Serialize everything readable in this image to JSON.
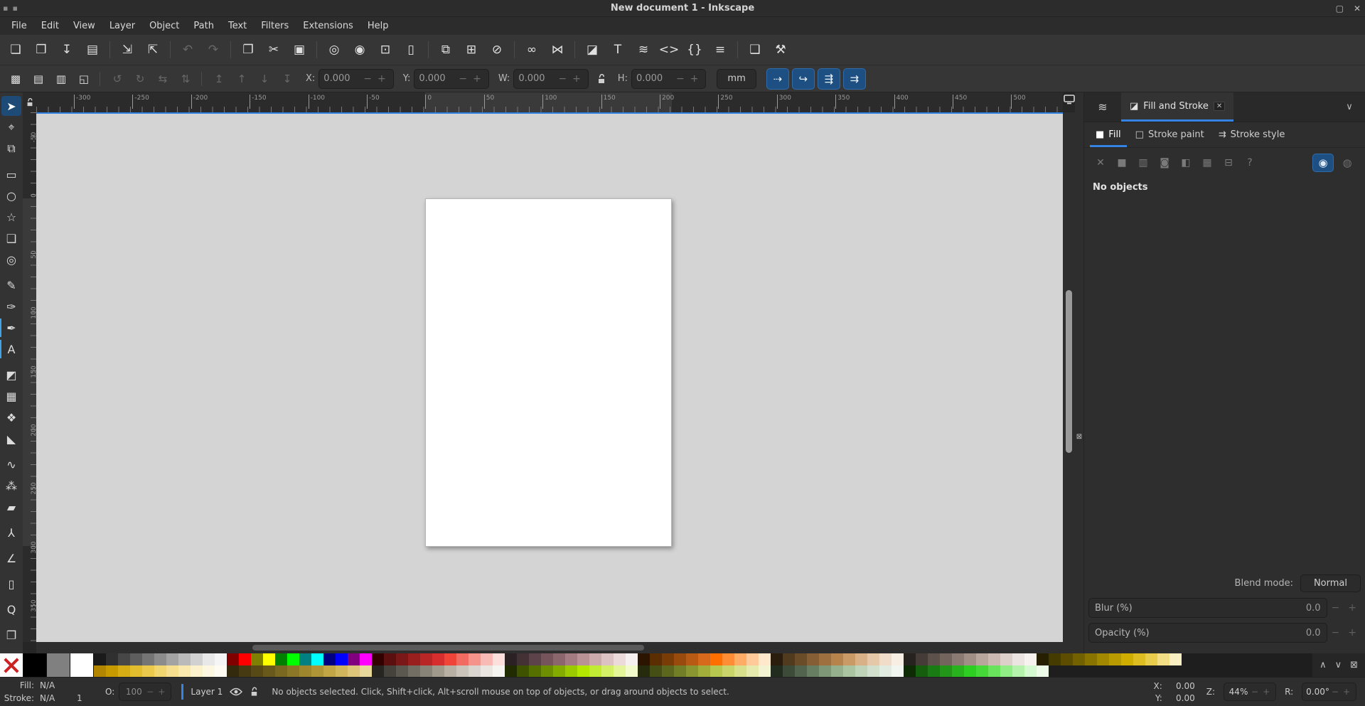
{
  "window": {
    "title": "New document 1 - Inkscape",
    "controls": {
      "restore": "▢",
      "close": "✕"
    },
    "app_menu_glyphs": [
      "▪",
      "▪"
    ]
  },
  "menubar": {
    "items": [
      {
        "name": "menu-file",
        "label": "File"
      },
      {
        "name": "menu-edit",
        "label": "Edit"
      },
      {
        "name": "menu-view",
        "label": "View"
      },
      {
        "name": "menu-layer",
        "label": "Layer"
      },
      {
        "name": "menu-object",
        "label": "Object"
      },
      {
        "name": "menu-path",
        "label": "Path"
      },
      {
        "name": "menu-text",
        "label": "Text"
      },
      {
        "name": "menu-filters",
        "label": "Filters"
      },
      {
        "name": "menu-extensions",
        "label": "Extensions"
      },
      {
        "name": "menu-help",
        "label": "Help"
      }
    ]
  },
  "command_toolbar": {
    "buttons": [
      {
        "name": "new-document-button",
        "glyph": "❏"
      },
      {
        "name": "open-document-button",
        "glyph": "❒"
      },
      {
        "name": "save-document-button",
        "glyph": "↧"
      },
      {
        "name": "print-button",
        "glyph": "▤",
        "sep_after": true
      },
      {
        "name": "import-button",
        "glyph": "⇲"
      },
      {
        "name": "export-button",
        "glyph": "⇱",
        "sep_after": true
      },
      {
        "name": "undo-button",
        "glyph": "↶",
        "disabled": true
      },
      {
        "name": "redo-button",
        "glyph": "↷",
        "disabled": true,
        "sep_after": true
      },
      {
        "name": "copy-button",
        "glyph": "❐"
      },
      {
        "name": "cut-button",
        "glyph": "✂"
      },
      {
        "name": "paste-button",
        "glyph": "▣",
        "sep_after": true
      },
      {
        "name": "zoom-selection-button",
        "glyph": "◎"
      },
      {
        "name": "zoom-drawing-button",
        "glyph": "◉"
      },
      {
        "name": "zoom-page-button",
        "glyph": "⊡"
      },
      {
        "name": "zoom-page-width-button",
        "glyph": "▯",
        "sep_after": true
      },
      {
        "name": "duplicate-button",
        "glyph": "⧉"
      },
      {
        "name": "clone-button",
        "glyph": "⊞"
      },
      {
        "name": "unlink-clone-button",
        "glyph": "⊘",
        "sep_after": true
      },
      {
        "name": "group-button",
        "glyph": "∞"
      },
      {
        "name": "ungroup-button",
        "glyph": "⋈",
        "sep_after": true
      },
      {
        "name": "fill-stroke-dialog-button",
        "glyph": "◪"
      },
      {
        "name": "text-dialog-button",
        "glyph": "T"
      },
      {
        "name": "layers-dialog-button",
        "glyph": "≋"
      },
      {
        "name": "xml-editor-button",
        "glyph": "<>"
      },
      {
        "name": "symbols-dialog-button",
        "glyph": "{}"
      },
      {
        "name": "align-distribute-button",
        "glyph": "≡",
        "sep_after": true
      },
      {
        "name": "document-properties-button",
        "glyph": "❑"
      },
      {
        "name": "preferences-button",
        "glyph": "⚒"
      }
    ]
  },
  "tool_options": {
    "selection_buttons": [
      {
        "name": "select-all-button",
        "glyph": "▩"
      },
      {
        "name": "select-all-layers-button",
        "glyph": "▤"
      },
      {
        "name": "deselect-button",
        "glyph": "▥"
      },
      {
        "name": "selection-box-button",
        "glyph": "◱",
        "sep_after": true
      }
    ],
    "transform_buttons": [
      {
        "name": "rotate-ccw-button",
        "glyph": "↺",
        "disabled": true
      },
      {
        "name": "rotate-cw-button",
        "glyph": "↻",
        "disabled": true
      },
      {
        "name": "flip-horizontal-button",
        "glyph": "⇆",
        "disabled": true
      },
      {
        "name": "flip-vertical-button",
        "glyph": "⇅",
        "disabled": true,
        "sep_after": true
      }
    ],
    "zorder_buttons": [
      {
        "name": "raise-to-top-button",
        "glyph": "↥",
        "disabled": true
      },
      {
        "name": "raise-button",
        "glyph": "↑",
        "disabled": true
      },
      {
        "name": "lower-button",
        "glyph": "↓",
        "disabled": true
      },
      {
        "name": "lower-to-bottom-button",
        "glyph": "↧",
        "disabled": true
      }
    ],
    "fields": [
      {
        "name": "x-field",
        "label": "X:",
        "value": "0.000"
      },
      {
        "name": "y-field",
        "label": "Y:",
        "value": "0.000"
      },
      {
        "name": "w-field",
        "label": "W:",
        "value": "0.000"
      },
      {
        "name": "h-field",
        "label": "H:",
        "value": "0.000"
      }
    ],
    "unit": "mm",
    "affect_toggles": [
      {
        "name": "move-when-transforming-toggle",
        "glyph": "⇢"
      },
      {
        "name": "scale-rounded-corners-toggle",
        "glyph": "↪"
      },
      {
        "name": "move-gradients-toggle",
        "glyph": "⇶"
      },
      {
        "name": "move-patterns-toggle",
        "glyph": "⇉"
      }
    ]
  },
  "toolbox": {
    "tools": [
      {
        "name": "selector-tool",
        "glyph": "➤",
        "active": true
      },
      {
        "name": "node-tool",
        "glyph": "⌖"
      },
      {
        "name": "shape-builder-tool",
        "glyph": "⧉"
      },
      {
        "name": "rectangle-tool",
        "glyph": "▭",
        "gap": true
      },
      {
        "name": "ellipse-tool",
        "glyph": "○"
      },
      {
        "name": "star-tool",
        "glyph": "☆"
      },
      {
        "name": "box-3d-tool",
        "glyph": "❑"
      },
      {
        "name": "spiral-tool",
        "glyph": "◎"
      },
      {
        "name": "pencil-tool",
        "glyph": "✎",
        "gap": true
      },
      {
        "name": "pen-tool",
        "glyph": "✑"
      },
      {
        "name": "calligraphy-tool",
        "glyph": "✒",
        "marked": true
      },
      {
        "name": "text-tool",
        "glyph": "A",
        "marked": true
      },
      {
        "name": "gradient-tool",
        "glyph": "◩",
        "gap": true
      },
      {
        "name": "mesh-gradient-tool",
        "glyph": "▦"
      },
      {
        "name": "dropper-tool",
        "glyph": "❖"
      },
      {
        "name": "paint-bucket-tool",
        "glyph": "◣"
      },
      {
        "name": "tweak-tool",
        "glyph": "∿",
        "gap": true
      },
      {
        "name": "spray-tool",
        "glyph": "⁂"
      },
      {
        "name": "eraser-tool",
        "glyph": "▰"
      },
      {
        "name": "connector-tool",
        "glyph": "⅄",
        "gap": true
      },
      {
        "name": "measure-tool",
        "glyph": "∠",
        "gap": true
      },
      {
        "name": "page-tool",
        "glyph": "▯",
        "gap": true
      },
      {
        "name": "zoom-tool",
        "glyph": "Q",
        "gap": true
      },
      {
        "name": "pages-tool",
        "glyph": "❐",
        "gap": true
      }
    ]
  },
  "rulers": {
    "horizontal_labels": [
      "-300",
      "-250",
      "-200",
      "-150",
      "-100",
      "-50",
      "0",
      "50",
      "100",
      "150",
      "200",
      "250",
      "300",
      "350",
      "400",
      "450",
      "500"
    ],
    "vertical_labels": [
      "-50",
      "0",
      "50",
      "100",
      "150",
      "200",
      "250",
      "300",
      "350"
    ]
  },
  "panel": {
    "dock": {
      "aux_tab_glyph": "≋",
      "tab_icon": "◪",
      "title": "Fill and Stroke",
      "close_glyph": "✕",
      "collapse_glyph": "∨"
    },
    "tabs": [
      {
        "name": "tab-fill",
        "icon": "■",
        "label": "Fill",
        "active": true
      },
      {
        "name": "tab-stroke-paint",
        "icon": "□",
        "label": "Stroke paint"
      },
      {
        "name": "tab-stroke-style",
        "icon": "⇉",
        "label": "Stroke style"
      }
    ],
    "paint_types": [
      {
        "name": "no-paint-button",
        "glyph": "✕"
      },
      {
        "name": "flat-color-button",
        "glyph": "■"
      },
      {
        "name": "linear-gradient-button",
        "glyph": "▥"
      },
      {
        "name": "radial-gradient-button",
        "glyph": "◙"
      },
      {
        "name": "pattern-button",
        "glyph": "◧"
      },
      {
        "name": "swatch-button",
        "glyph": "▦"
      },
      {
        "name": "mesh-gradient-button",
        "glyph": "⊟"
      },
      {
        "name": "unknown-paint-button",
        "glyph": "?"
      }
    ],
    "fill_rules": [
      {
        "name": "fill-rule-nonzero-button",
        "glyph": "◉",
        "active": true
      },
      {
        "name": "fill-rule-evenodd-button",
        "glyph": "◍"
      }
    ],
    "status_text": "No objects",
    "blend": {
      "label": "Blend mode:",
      "value": "Normal"
    },
    "blur": {
      "label": "Blur (%)",
      "value": "0.0"
    },
    "opacity": {
      "label": "Opacity (%)",
      "value": "0.0"
    }
  },
  "palette": {
    "big_swatches": [
      "#000000",
      "#808080",
      "#ffffff"
    ],
    "row_top": [
      "#1a1a1a",
      "#303030",
      "#474747",
      "#5e5e5e",
      "#757575",
      "#8c8c8c",
      "#a3a3a3",
      "#bababa",
      "#d1d1d1",
      "#e8e8e8",
      "#f5f5f5",
      "#800000",
      "#ff0000",
      "#808000",
      "#ffff00",
      "#008000",
      "#00ff00",
      "#008080",
      "#00ffff",
      "#000080",
      "#0000ff",
      "#800080",
      "#ff00ff",
      "#330000",
      "#5c0f0f",
      "#7a1717",
      "#991f1f",
      "#b82626",
      "#d62e2e",
      "#ef4437",
      "#f26b60",
      "#f5928a",
      "#f9b9b4",
      "#fcdfdd",
      "#2b2023",
      "#443136",
      "#5c4349",
      "#75545c",
      "#8c666d",
      "#a37b80",
      "#b99295",
      "#ccaaac",
      "#ddc2c3",
      "#ecdadb",
      "#f7f0f0",
      "#2b1500",
      "#5c2d00",
      "#7a3c07",
      "#994b0e",
      "#b85a14",
      "#d6691b",
      "#ff6f00",
      "#ff8d33",
      "#ffac66",
      "#ffca99",
      "#ffe8cc",
      "#2b1d0e",
      "#523a1e",
      "#6b4c29",
      "#855e35",
      "#9e7040",
      "#b7834d",
      "#c99a66",
      "#d8b186",
      "#e5c8a8",
      "#f0dcc9",
      "#f8eee4",
      "#262220",
      "#453c38",
      "#5c514b",
      "#73655e",
      "#8a7a71",
      "#a18f85",
      "#b8a59b",
      "#ccbab2",
      "#ddd0ca",
      "#ebe4e0",
      "#f6f2f0",
      "#262000",
      "#453a00",
      "#5c4d00",
      "#736100",
      "#8a7400",
      "#a18800",
      "#b89b00",
      "#cfae00",
      "#ddbd1f",
      "#e8cd4d",
      "#f1de85",
      "#f9efc2"
    ],
    "row_bottom": [
      "#b38600",
      "#c79b00",
      "#d6ad14",
      "#e2bd2e",
      "#ebc94d",
      "#f1d56e",
      "#f6e08f",
      "#f9e9ae",
      "#fbf1ca",
      "#fdf7e1",
      "#fefcf2",
      "#332a0d",
      "#453a11",
      "#574a16",
      "#69591b",
      "#7a6820",
      "#8c7726",
      "#9e862d",
      "#b09536",
      "#c2a545",
      "#d0b55c",
      "#ddc67a",
      "#e9d89c",
      "#26251f",
      "#44423a",
      "#5b5850",
      "#726e64",
      "#898478",
      "#a09a8d",
      "#b7b0a3",
      "#cac4ba",
      "#dad5ce",
      "#e9e6e1",
      "#f5f4f1",
      "#202b00",
      "#3f5200",
      "#567000",
      "#6d8e00",
      "#84ac00",
      "#9bca00",
      "#b2e800",
      "#c2ec33",
      "#d3f066",
      "#e4f599",
      "#f2facc",
      "#262b0d",
      "#454f14",
      "#5c671d",
      "#737f26",
      "#8a9730",
      "#a1af3a",
      "#b8c74d",
      "#c9d46b",
      "#d8e08c",
      "#e6ebad",
      "#f2f4d1",
      "#212b1e",
      "#3c4a38",
      "#52644d",
      "#687e62",
      "#7e9877",
      "#94b08c",
      "#aac4a2",
      "#bed3b8",
      "#d1e0cd",
      "#e2ebdf",
      "#f2f6f0",
      "#0d2b05",
      "#145e0e",
      "#1a7a13",
      "#219618",
      "#28b21d",
      "#2ece23",
      "#44d936",
      "#6ae35c",
      "#90ec85",
      "#b5f3ad",
      "#d5f9d0",
      "#edfce9"
    ],
    "controls": {
      "scroll_up": "∧",
      "scroll_down": "∨",
      "configure": "⊠"
    }
  },
  "statusbar": {
    "fill_label": "Fill:",
    "fill_value": "N/A",
    "stroke_label": "Stroke:",
    "stroke_value": "N/A",
    "stroke_width": "1",
    "opacity_label": "O:",
    "opacity_value": "100",
    "layer_name": "Layer 1",
    "message": "No objects selected. Click, Shift+click, Alt+scroll mouse on top of objects, or drag around objects to select.",
    "x_label": "X:",
    "x_value": "0.00",
    "y_label": "Y:",
    "y_value": "0.00",
    "zoom_label": "Z:",
    "zoom_value": "44%",
    "rotation_label": "R:",
    "rotation_value": "0.00°"
  },
  "colors": {
    "accent": "#3584e4",
    "toolbar_bg": "#363636",
    "canvas_bg": "#d4d4d4",
    "panel_bg": "#2e2e2e"
  }
}
